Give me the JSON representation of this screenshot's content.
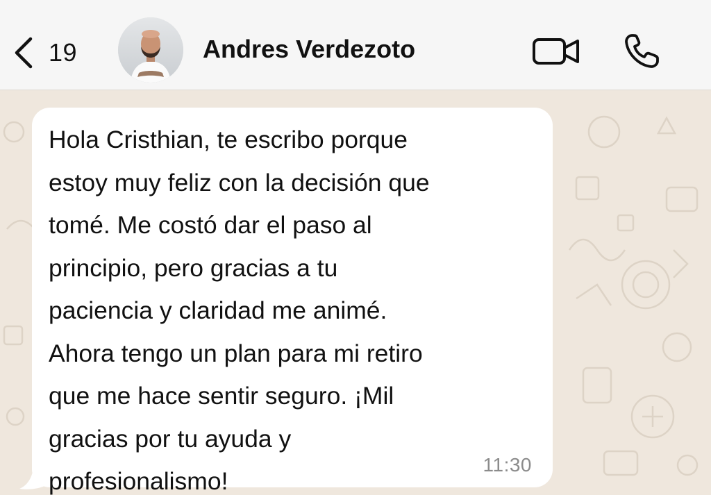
{
  "header": {
    "unread_count": "19",
    "contact_name": "Andres Verdezoto",
    "icons": {
      "back": "chevron-left-icon",
      "video": "video-camera-icon",
      "call": "phone-icon"
    }
  },
  "chat": {
    "messages": [
      {
        "direction": "incoming",
        "text": "Hola Cristhian, te escribo porque\nestoy muy feliz con la decisión que\ntomé. Me costó dar el paso al\nprincipio, pero gracias a tu\npaciencia y claridad me animé.\nAhora tengo un plan para mi retiro\nque me hace sentir seguro. ¡Mil\ngracias por tu ayuda y\nprofesionalismo!",
        "time": "11:30"
      }
    ]
  },
  "colors": {
    "header_bg": "#f6f6f6",
    "chat_bg": "#efe7dd",
    "bubble_bg": "#ffffff",
    "timestamp": "#8b8b8b"
  }
}
